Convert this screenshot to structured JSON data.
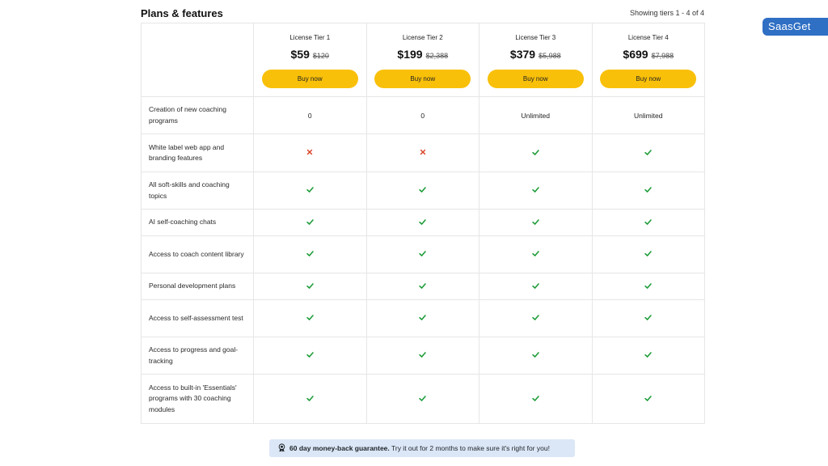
{
  "header": {
    "title": "Plans & features",
    "showing": "Showing tiers 1 - 4 of 4"
  },
  "logo": {
    "text": "SaasGet"
  },
  "tiers": [
    {
      "name": "License Tier 1",
      "price": "$59",
      "old_price": "$120",
      "button": "Buy now"
    },
    {
      "name": "License Tier 2",
      "price": "$199",
      "old_price": "$2,388",
      "button": "Buy now"
    },
    {
      "name": "License Tier 3",
      "price": "$379",
      "old_price": "$5,988",
      "button": "Buy now"
    },
    {
      "name": "License Tier 4",
      "price": "$699",
      "old_price": "$7,988",
      "button": "Buy now"
    }
  ],
  "features": [
    {
      "label": "Creation of new coaching programs",
      "values": [
        "0",
        "0",
        "Unlimited",
        "Unlimited"
      ]
    },
    {
      "label": "White label web app and branding features",
      "values": [
        "cross",
        "cross",
        "check",
        "check"
      ]
    },
    {
      "label": "All soft-skills and coaching topics",
      "values": [
        "check",
        "check",
        "check",
        "check"
      ]
    },
    {
      "label": "AI self-coaching chats",
      "values": [
        "check",
        "check",
        "check",
        "check"
      ]
    },
    {
      "label": "Access to coach content library",
      "values": [
        "check",
        "check",
        "check",
        "check"
      ]
    },
    {
      "label": "Personal development plans",
      "values": [
        "check",
        "check",
        "check",
        "check"
      ]
    },
    {
      "label": "Access to self-assessment test",
      "values": [
        "check",
        "check",
        "check",
        "check"
      ]
    },
    {
      "label": "Access to progress and goal-tracking",
      "values": [
        "check",
        "check",
        "check",
        "check"
      ]
    },
    {
      "label": "Access to built-in 'Essentials' programs with 30 coaching modules",
      "values": [
        "check",
        "check",
        "check",
        "check"
      ]
    }
  ],
  "colors": {
    "check": "#1f9d3a",
    "cross": "#d9472b",
    "button": "#f9c00a",
    "guarantee_bg": "#dbe7f7",
    "logo_bg": "#2f6fc4"
  },
  "guarantee": {
    "icon": "badge-icon",
    "bold": "60 day money-back guarantee.",
    "text": " Try it out for 2 months to make sure it's right for you!"
  }
}
